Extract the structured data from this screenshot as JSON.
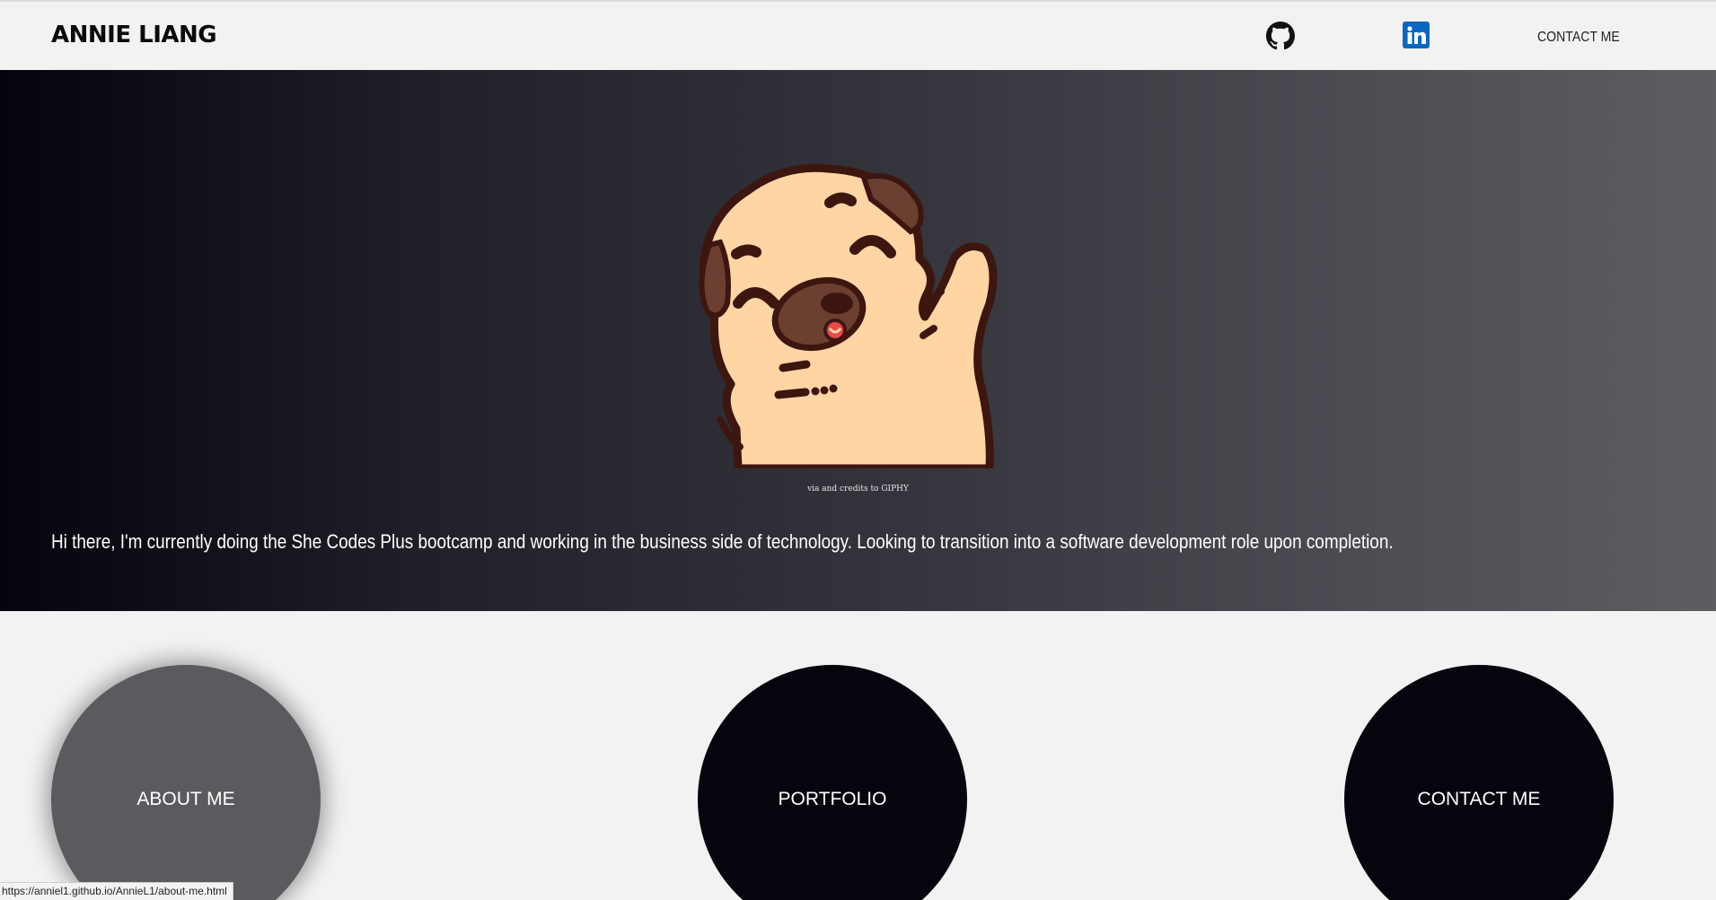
{
  "header": {
    "brand": "ANNIE LIANG",
    "github_icon": "github-icon",
    "linkedin_icon": "linkedin-icon",
    "nav_contact": "CONTACT ME",
    "colors": {
      "linkedin": "#0a66c2"
    }
  },
  "hero": {
    "image": "waving-pug",
    "credit": "via and credits to GIPHY",
    "intro": "Hi there, I'm currently doing the She Codes Plus bootcamp and working in the business side of technology. Looking to transition into a software development role upon completion."
  },
  "circles": [
    {
      "label": "ABOUT ME",
      "state": "hover"
    },
    {
      "label": "PORTFOLIO"
    },
    {
      "label": "CONTACT ME"
    }
  ],
  "status_bar": {
    "url": "https://anniel1.github.io/AnnieL1/about-me.html"
  }
}
